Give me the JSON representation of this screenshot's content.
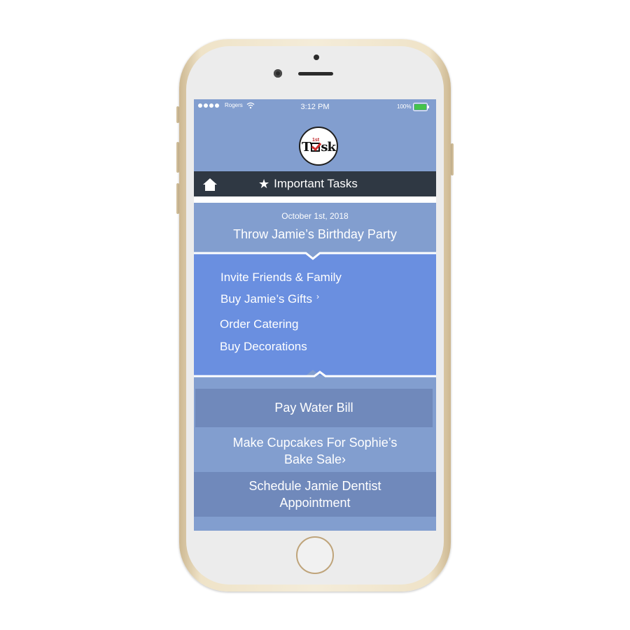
{
  "statusbar": {
    "carrier": "Rogers",
    "time": "3:12 PM",
    "battery": "100%"
  },
  "app": {
    "logo_small": "1st",
    "logo_word_left": "T",
    "logo_word_right": "sk"
  },
  "navbar": {
    "title": "Important Tasks"
  },
  "featured_task": {
    "date": "October 1st,  2018",
    "title": "Throw Jamie’s Birthday Party",
    "subtasks": [
      {
        "label": "Invite Friends & Family",
        "has_chevron": false
      },
      {
        "label": "Buy Jamie’s Gifts",
        "has_chevron": true,
        "chevron": "›"
      },
      {
        "label": "Order Catering",
        "has_chevron": false
      },
      {
        "label": "Buy Decorations",
        "has_chevron": false
      }
    ]
  },
  "tasks": [
    {
      "line1": "Pay Water Bill",
      "line2": ""
    },
    {
      "line1": "Make Cupcakes For Sophie’s",
      "line2": "Bake Sale",
      "chevron": "›"
    },
    {
      "line1": "Schedule Jamie Dentist",
      "line2": "Appointment"
    }
  ],
  "colors": {
    "screen_bg": "#829ecf",
    "navbar_bg": "#2f3843",
    "expanded_bg": "#6a8fe0",
    "row_dark_bg": "#7089bb",
    "logo_check": "#d12c2c"
  }
}
